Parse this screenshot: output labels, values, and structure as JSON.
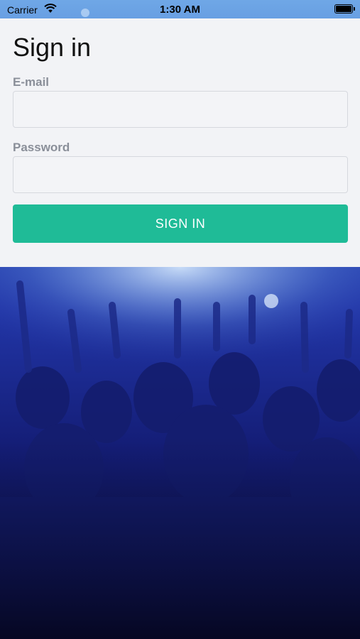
{
  "status_bar": {
    "carrier": "Carrier",
    "time": "1:30 AM"
  },
  "sign_in": {
    "title": "Sign in",
    "email_label": "E-mail",
    "email_value": "",
    "password_label": "Password",
    "password_value": "",
    "button_label": "SIGN IN"
  },
  "colors": {
    "accent": "#1fbb97",
    "panel": "#f2f3f6",
    "label": "#8a8f99"
  },
  "icons": [
    "wifi-icon",
    "battery-icon"
  ]
}
